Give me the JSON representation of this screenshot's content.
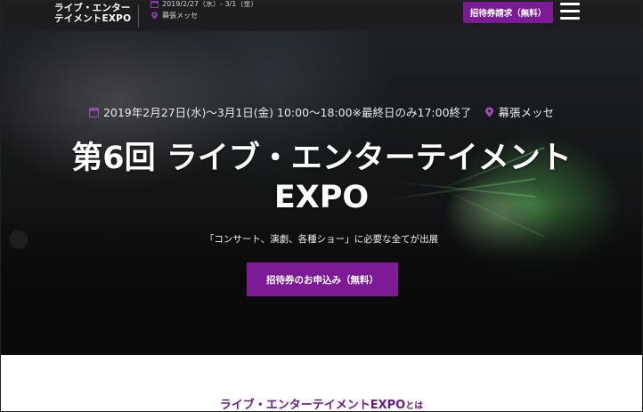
{
  "header": {
    "logo_line1": "ライブ・エンター",
    "logo_line2": "テイメントEXPO",
    "date": "2019/2/27（水）- 3/1（金）",
    "venue": "幕張メッセ",
    "cta_label": "招待券請求（無料）"
  },
  "hero": {
    "date_text": "2019年2月27日(水)〜3月1日(金) 10:00〜18:00※最終日のみ17:00終了",
    "venue": "幕張メッセ",
    "title_line1": "第6回 ライブ・エンターテイメント",
    "title_line2": "EXPO",
    "subtitle": "「コンサート、演劇、各種ショー」に必要な全てが出展",
    "cta_label": "招待券のお申込み（無料）"
  },
  "about": {
    "title_main": "ライブ・エンターテイメントEXPO",
    "title_suffix": "とは"
  },
  "colors": {
    "accent": "#7d1b96",
    "header_bg": "#1d1d1f",
    "about_title": "#6a1a80"
  },
  "icons": {
    "calendar": "calendar-icon",
    "location": "location-pin-icon",
    "menu": "hamburger-menu-icon"
  }
}
